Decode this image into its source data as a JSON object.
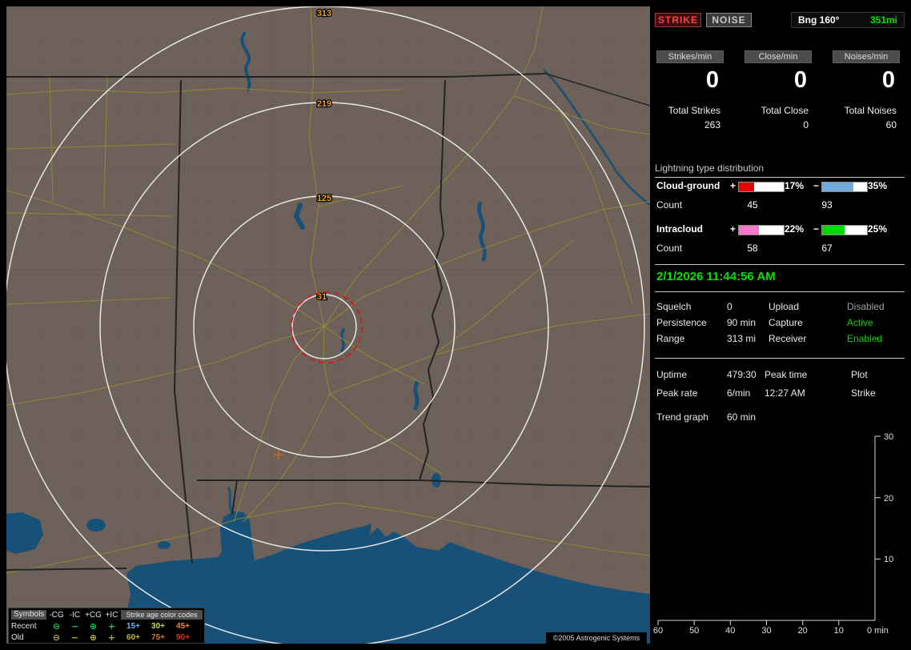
{
  "map": {
    "ring_labels": [
      "313",
      "219",
      "125",
      "31"
    ],
    "legend": {
      "symbols_header": "Symbols",
      "age_header": "Strike age color codes",
      "columns": [
        "-CG",
        "-IC",
        "+CG",
        "+IC"
      ],
      "rows": [
        {
          "label": "Recent",
          "symbol_color": "#00c865",
          "symbols": [
            "⊖",
            "−",
            "⊕",
            "+"
          ],
          "ages": [
            {
              "text": "15+",
              "color": "#6cb4f8"
            },
            {
              "text": "30+",
              "color": "#d8d850"
            },
            {
              "text": "45+",
              "color": "#e89030"
            }
          ]
        },
        {
          "label": "Old",
          "symbol_color": "#b4b420",
          "symbols": [
            "⊖",
            "−",
            "⊕",
            "+"
          ],
          "ages": [
            {
              "text": "60+",
              "color": "#c0b828"
            },
            {
              "text": "75+",
              "color": "#d87820"
            },
            {
              "text": "90+",
              "color": "#e23028"
            }
          ]
        }
      ]
    },
    "copyright": "©2005 Astrogenic Systems"
  },
  "panel": {
    "strike_button": "STRIKE",
    "noise_button": "NOISE",
    "bearing_label": "Bng 160°",
    "bearing_range": "351mi",
    "rates": [
      {
        "label": "Strikes/min",
        "value": "0"
      },
      {
        "label": "Close/min",
        "value": "0"
      },
      {
        "label": "Noises/min",
        "value": "0"
      }
    ],
    "totals": [
      {
        "label": "Total Strikes",
        "value": "263"
      },
      {
        "label": "Total Close",
        "value": "0"
      },
      {
        "label": "Total Noises",
        "value": "60"
      }
    ],
    "distribution": {
      "title": "Lightning type distribution",
      "pos_sign": "+",
      "neg_sign": "−",
      "count_label": "Count",
      "rows": [
        {
          "label": "Cloud-ground",
          "pos_pct": "17%",
          "pos_fill": 34,
          "pos_color": "#e60000",
          "neg_pct": "35%",
          "neg_fill": 70,
          "neg_color": "#72aadc",
          "pos_count": "45",
          "neg_count": "93"
        },
        {
          "label": "Intracloud",
          "pos_pct": "22%",
          "pos_fill": 44,
          "pos_color": "#f478c8",
          "neg_pct": "25%",
          "neg_fill": 50,
          "neg_color": "#00d800",
          "pos_count": "58",
          "neg_count": "67"
        }
      ]
    },
    "datetime": "2/1/2026 11:44:56 AM",
    "settings": [
      {
        "label": "Squelch",
        "value": "0"
      },
      {
        "label": "Persistence",
        "value": "90 min"
      },
      {
        "label": "Range",
        "value": "313 mi"
      }
    ],
    "status": [
      {
        "label": "Upload",
        "value": "Disabled",
        "color": "#a0a0a0"
      },
      {
        "label": "Capture",
        "value": "Active",
        "color": "#00d800"
      },
      {
        "label": "Receiver",
        "value": "Enabled",
        "color": "#00d800"
      }
    ],
    "stats": {
      "uptime_label": "Uptime",
      "uptime_value": "479:30",
      "peak_rate_label": "Peak rate",
      "peak_rate_value": "6/min",
      "peak_time_label": "Peak time",
      "peak_time_value": "12:27 AM",
      "plot_label": "Plot",
      "plot_value": "Strike"
    },
    "trend": {
      "label": "Trend graph",
      "value": "60 min",
      "y_ticks": [
        "30",
        "20",
        "10"
      ],
      "x_ticks": [
        "60",
        "50",
        "40",
        "30",
        "20",
        "10"
      ],
      "origin_label": "0 min"
    },
    "colors": {
      "strike": "#ff4040",
      "noise": "#c8c8c8",
      "accent_green": "#00e400",
      "ring_label": "#f0a028"
    }
  },
  "chart_data": {
    "type": "line",
    "title": "Trend graph",
    "xlabel": "min",
    "xlim": [
      60,
      0
    ],
    "ylim": [
      0,
      30
    ],
    "x_ticks": [
      60,
      50,
      40,
      30,
      20,
      10,
      0
    ],
    "y_ticks": [
      0,
      10,
      20,
      30
    ],
    "series": []
  }
}
